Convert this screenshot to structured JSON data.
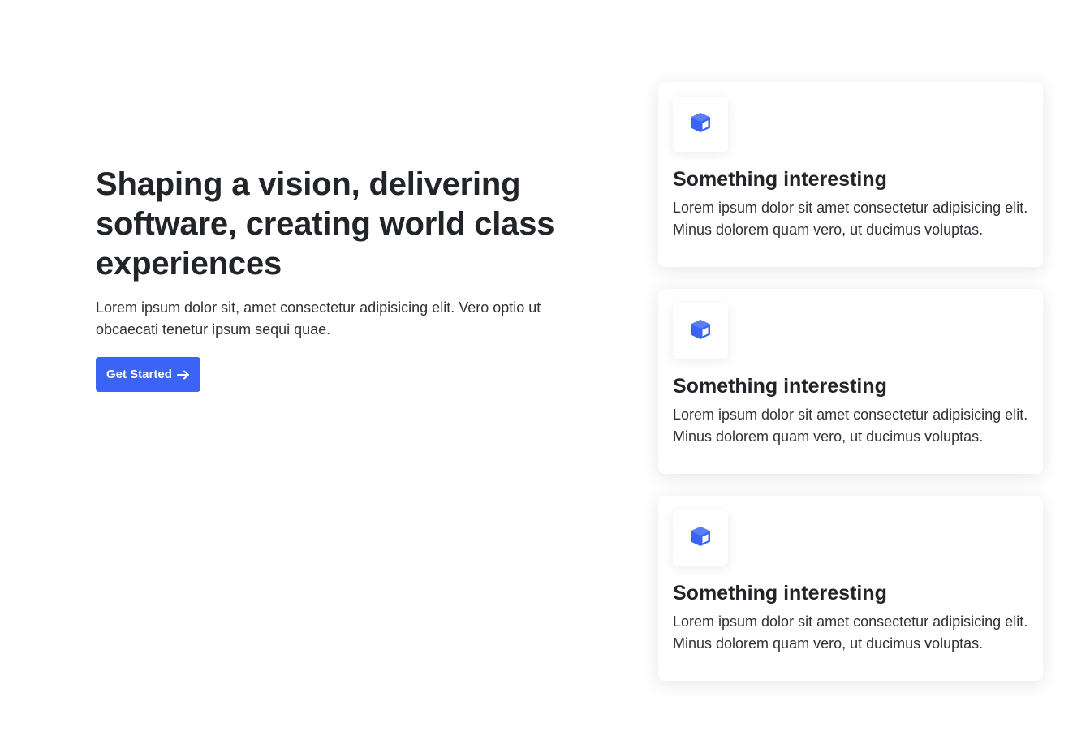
{
  "hero": {
    "title": "Shaping a vision, delivering software, creating world class experiences",
    "text": "Lorem ipsum dolor sit, amet consectetur adipisicing elit. Vero optio ut obcaecati tenetur ipsum sequi quae.",
    "button_label": "Get Started",
    "button_icon": "arrow-right-icon"
  },
  "features": [
    {
      "icon": "box-icon",
      "title": "Something interesting",
      "text": "Lorem ipsum dolor sit amet consectetur adipisicing elit. Minus dolorem quam vero, ut ducimus voluptas."
    },
    {
      "icon": "box-icon",
      "title": "Something interesting",
      "text": "Lorem ipsum dolor sit amet consectetur adipisicing elit. Minus dolorem quam vero, ut ducimus voluptas."
    },
    {
      "icon": "box-icon",
      "title": "Something interesting",
      "text": "Lorem ipsum dolor sit amet consectetur adipisicing elit. Minus dolorem quam vero, ut ducimus voluptas."
    }
  ],
  "colors": {
    "accent": "#3b63f5",
    "text": "#212529",
    "background": "#ffffff"
  }
}
